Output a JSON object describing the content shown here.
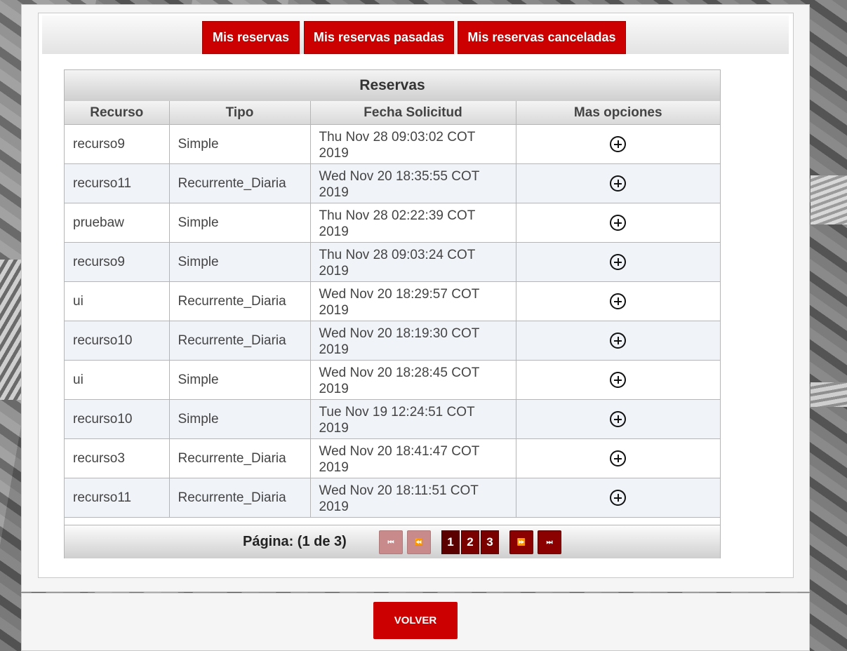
{
  "tabs": [
    {
      "label": "Mis reservas"
    },
    {
      "label": "Mis reservas pasadas"
    },
    {
      "label": "Mis reservas canceladas"
    }
  ],
  "table": {
    "caption": "Reservas",
    "columns": [
      "Recurso",
      "Tipo",
      "Fecha Solicitud",
      "Mas opciones"
    ],
    "rows": [
      {
        "recurso": "recurso9",
        "tipo": "Simple",
        "fecha_l1": "Thu Nov 28 09:03:02 COT",
        "fecha_l2": "2019"
      },
      {
        "recurso": "recurso11",
        "tipo": "Recurrente_Diaria",
        "fecha_l1": "Wed Nov 20 18:35:55 COT",
        "fecha_l2": "2019"
      },
      {
        "recurso": "pruebaw",
        "tipo": "Simple",
        "fecha_l1": "Thu Nov 28 02:22:39 COT",
        "fecha_l2": "2019"
      },
      {
        "recurso": "recurso9",
        "tipo": "Simple",
        "fecha_l1": "Thu Nov 28 09:03:24 COT",
        "fecha_l2": "2019"
      },
      {
        "recurso": "ui",
        "tipo": "Recurrente_Diaria",
        "fecha_l1": "Wed Nov 20 18:29:57 COT",
        "fecha_l2": "2019"
      },
      {
        "recurso": "recurso10",
        "tipo": "Recurrente_Diaria",
        "fecha_l1": "Wed Nov 20 18:19:30 COT",
        "fecha_l2": "2019"
      },
      {
        "recurso": "ui",
        "tipo": "Simple",
        "fecha_l1": "Wed Nov 20 18:28:45 COT",
        "fecha_l2": "2019"
      },
      {
        "recurso": "recurso10",
        "tipo": "Simple",
        "fecha_l1": "Tue Nov 19 12:24:51 COT",
        "fecha_l2": "2019"
      },
      {
        "recurso": "recurso3",
        "tipo": "Recurrente_Diaria",
        "fecha_l1": "Wed Nov 20 18:41:47 COT",
        "fecha_l2": "2019"
      },
      {
        "recurso": "recurso11",
        "tipo": "Recurrente_Diaria",
        "fecha_l1": "Wed Nov 20 18:11:51 COT",
        "fecha_l2": "2019"
      }
    ],
    "row_icon": "plus-circle-icon"
  },
  "paginator": {
    "label": "Página: (1 de 3)",
    "first_icon": "first-page-icon",
    "prev_icon": "prev-page-icon",
    "next_icon": "next-page-icon",
    "last_icon": "last-page-icon",
    "pages": [
      "1",
      "2",
      "3"
    ],
    "current_page": "1"
  },
  "footer": {
    "volver_label": "VOLVER"
  },
  "colors": {
    "accent": "#cc0000",
    "paginator_button": "#8b0000",
    "alt_row": "#f0f3f8"
  }
}
